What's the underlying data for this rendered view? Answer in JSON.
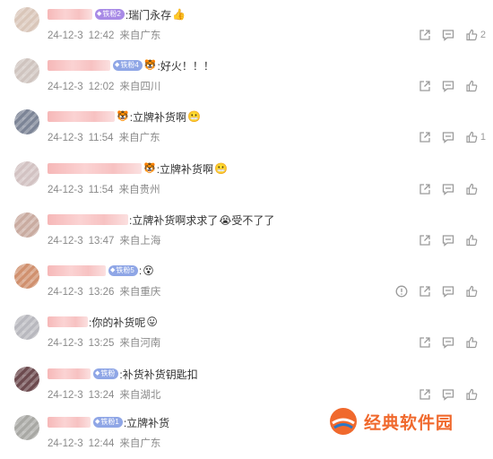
{
  "comments": [
    {
      "avatar_color": "#d9c6b9",
      "name_width": 50,
      "badge": {
        "text": "铁粉2",
        "style": "purple"
      },
      "prefix_emoji": "",
      "text": ":瑞门永存",
      "suffix_emoji": "👍",
      "date": "24-12-3",
      "time": "12:42",
      "location": "来自广东",
      "actions": [
        "share-icon",
        "reply-icon",
        "like-icon"
      ],
      "likes": "2"
    },
    {
      "avatar_color": "#cfc4bf",
      "name_width": 70,
      "badge": {
        "text": "铁粉4",
        "style": "blue"
      },
      "prefix_emoji": "🐯",
      "text": ":好火！！！",
      "suffix_emoji": "",
      "date": "24-12-3",
      "time": "12:02",
      "location": "来自四川",
      "actions": [
        "share-icon",
        "reply-icon",
        "like-icon"
      ],
      "likes": ""
    },
    {
      "avatar_color": "#7c8496",
      "name_width": 75,
      "badge": null,
      "prefix_emoji": "🐯",
      "text": ":立牌补货啊",
      "suffix_emoji": "😬",
      "date": "24-12-3",
      "time": "11:54",
      "location": "来自广东",
      "actions": [
        "share-icon",
        "reply-icon",
        "like-icon"
      ],
      "likes": "1"
    },
    {
      "avatar_color": "#d2c2c2",
      "name_width": 105,
      "badge": null,
      "prefix_emoji": "🐯",
      "text": ":立牌补货啊",
      "suffix_emoji": "😬",
      "date": "24-12-3",
      "time": "11:54",
      "location": "来自贵州",
      "actions": [
        "share-icon",
        "reply-icon",
        "like-icon"
      ],
      "likes": ""
    },
    {
      "avatar_color": "#c9aba0",
      "name_width": 90,
      "badge": null,
      "prefix_emoji": "",
      "text": ":立牌补货啊求求了",
      "suffix_emoji": "😭受不了了",
      "date": "24-12-3",
      "time": "13:47",
      "location": "来自上海",
      "actions": [
        "share-icon",
        "reply-icon",
        "like-icon"
      ],
      "likes": ""
    },
    {
      "avatar_color": "#d0906e",
      "name_width": 65,
      "badge": {
        "text": "铁粉5",
        "style": "blue"
      },
      "prefix_emoji": "",
      "text": ":",
      "suffix_emoji": "😵",
      "date": "24-12-3",
      "time": "13:26",
      "location": "来自重庆",
      "actions": [
        "warning-icon",
        "share-icon",
        "reply-icon",
        "like-icon"
      ],
      "likes": ""
    },
    {
      "avatar_color": "#b8b8be",
      "name_width": 45,
      "badge": null,
      "prefix_emoji": "",
      "text": ":你的补货呢",
      "suffix_emoji": "😛",
      "date": "24-12-3",
      "time": "13:25",
      "location": "来自河南",
      "actions": [
        "share-icon",
        "reply-icon",
        "like-icon"
      ],
      "likes": ""
    },
    {
      "avatar_color": "#6c4a4e",
      "name_width": 48,
      "badge": {
        "text": "铁粉",
        "style": "blue"
      },
      "prefix_emoji": "",
      "text": ":补货补货钥匙扣",
      "suffix_emoji": "",
      "date": "24-12-3",
      "time": "13:24",
      "location": "来自湖北",
      "actions": [
        "share-icon",
        "reply-icon",
        "like-icon"
      ],
      "likes": ""
    },
    {
      "avatar_color": "#a8a8a4",
      "name_width": 48,
      "badge": {
        "text": "铁粉1",
        "style": "blue"
      },
      "prefix_emoji": "",
      "text": ":立牌补货",
      "suffix_emoji": "",
      "date": "24-12-3",
      "time": "12:44",
      "location": "来自广东",
      "actions": [],
      "likes": ""
    }
  ],
  "watermark": {
    "text": "经典软件园",
    "color": "#f0692d"
  }
}
